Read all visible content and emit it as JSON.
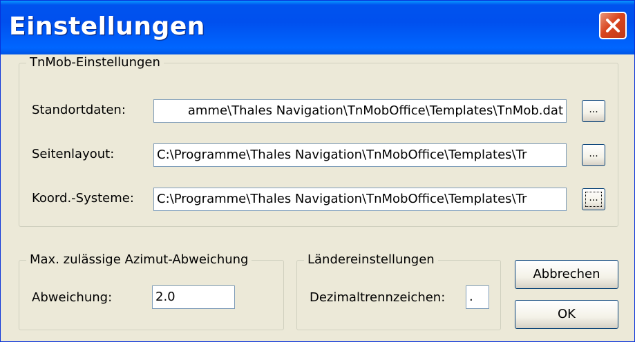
{
  "window": {
    "title": "Einstellungen",
    "close_label": "Close"
  },
  "tnmob_group": {
    "legend": "TnMob-Einstellungen",
    "rows": [
      {
        "label": "Standortdaten:",
        "value": "amme\\Thales Navigation\\TnMobOffice\\Templates\\TnMob.dat",
        "browse": "..."
      },
      {
        "label": "Seitenlayout:",
        "value": "C:\\Programme\\Thales Navigation\\TnMobOffice\\Templates\\Tr",
        "browse": "..."
      },
      {
        "label": "Koord.-Systeme:",
        "value": "C:\\Programme\\Thales Navigation\\TnMobOffice\\Templates\\Tr",
        "browse": "..."
      }
    ]
  },
  "azimut_group": {
    "legend": "Max. zulässige Azimut-Abweichung",
    "label": "Abweichung:",
    "value": "2.0"
  },
  "laender_group": {
    "legend": "Ländereinstellungen",
    "label": "Dezimaltrennzeichen:",
    "value": "."
  },
  "buttons": {
    "cancel": "Abbrechen",
    "ok": "OK"
  },
  "colors": {
    "titlebar": "#0053EE",
    "dialog_bg": "#ECE9D8",
    "close_button": "#D9451E"
  }
}
